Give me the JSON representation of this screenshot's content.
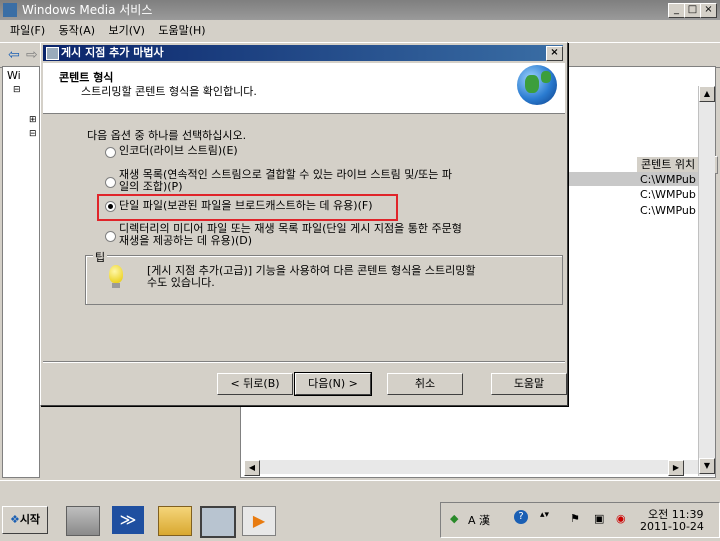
{
  "main_window": {
    "title": "Windows Media 서비스",
    "menu": [
      "파일(F)",
      "동작(A)",
      "보기(V)",
      "도움말(H)"
    ],
    "tree_root": "Wi",
    "column_header": "콘텐트 위치",
    "locations": [
      "C:\\WMPub",
      "C:\\WMPub",
      "C:\\WMPub"
    ]
  },
  "dialog": {
    "title": "게시 지점 추가 마법사",
    "header_title": "콘텐트 형식",
    "header_subtitle": "스트리밍할 콘텐트 형식을 확인합니다.",
    "prompt": "다음 옵션 중 하나를 선택하십시오.",
    "options": [
      {
        "line1": "인코더(라이브 스트림)(E)",
        "line2": ""
      },
      {
        "line1": "재생 목록(연속적인 스트림으로 결합할 수 있는 라이브 스트림 및/또는 파",
        "line2": "일의 조합)(P)"
      },
      {
        "line1": "단일 파일(보관된 파일을 브로드캐스트하는 데 유용)(F)",
        "line2": ""
      },
      {
        "line1": "디렉터리의 미디어 파일 또는 재생 목록 파일(단일 게시 지점을 통한 주문형",
        "line2": "재생을 제공하는 데 유용)(D)"
      }
    ],
    "selected_option": 2,
    "tip_label": "팁",
    "tip_line1": "[게시 지점 추가(고급)] 기능을 사용하여 다른 콘텐트 형식을 스트리밍할",
    "tip_line2": "수도 있습니다.",
    "buttons": {
      "back": "< 뒤로(B)",
      "next": "다음(N) >",
      "cancel": "취소",
      "help": "도움말"
    }
  },
  "taskbar": {
    "start_label": "시작",
    "tray_ime": "A 漢",
    "time": "오전 11:39",
    "date": "2011-10-24"
  },
  "colors": {
    "highlight": "#e0242a",
    "dialog_title": "#0a246a"
  }
}
